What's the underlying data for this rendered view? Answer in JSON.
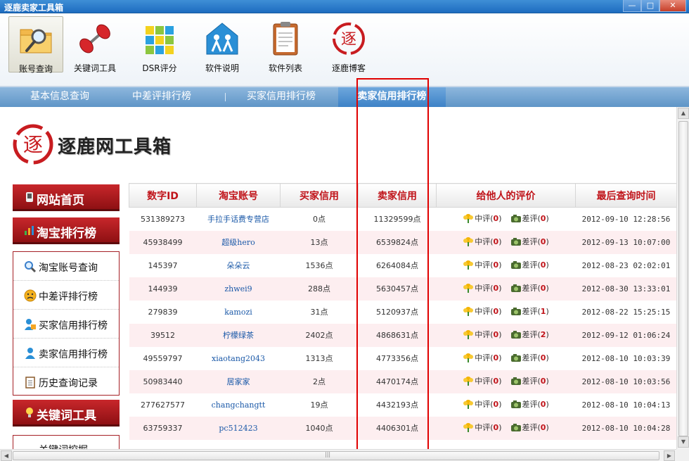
{
  "window": {
    "title": "逐鹿卖家工具箱",
    "min": "—",
    "max": "□",
    "close": "✕"
  },
  "toolbar": {
    "items": [
      {
        "label": "账号查询",
        "icon": "folder-search-icon"
      },
      {
        "label": "关键词工具",
        "icon": "dumbbell-icon"
      },
      {
        "label": "DSR评分",
        "icon": "cubes-icon"
      },
      {
        "label": "软件说明",
        "icon": "people-home-icon"
      },
      {
        "label": "软件列表",
        "icon": "clipboard-icon"
      },
      {
        "label": "逐鹿博客",
        "icon": "red-seal-icon"
      }
    ]
  },
  "tabs": [
    {
      "label": "基本信息查询"
    },
    {
      "label": "中差评排行榜"
    },
    {
      "label": "买家信用排行榜"
    },
    {
      "label": "卖家信用排行榜",
      "active": true
    }
  ],
  "logo": {
    "seal": "逐",
    "name": "逐鹿网工具箱"
  },
  "nav": {
    "home": "网站首页",
    "ranking": "淘宝排行榜",
    "items": [
      {
        "label": "淘宝账号查询",
        "icon": "magnifier-icon"
      },
      {
        "label": "中差评排行榜",
        "icon": "sad-face-icon"
      },
      {
        "label": "买家信用排行榜",
        "icon": "buyer-icon"
      },
      {
        "label": "卖家信用排行榜",
        "icon": "seller-icon"
      },
      {
        "label": "历史查询记录",
        "icon": "notepad-icon"
      }
    ],
    "keyword_tools": "关键词工具",
    "keyword_mining": "关键词挖掘"
  },
  "table": {
    "headers": [
      "数字ID",
      "淘宝账号",
      "买家信用",
      "卖家信用",
      "给他人的评价",
      "最后查询时间"
    ],
    "mid_label": "中评",
    "bad_label": "差评",
    "rows": [
      {
        "id": "531389273",
        "account": "手拉手话费专营店",
        "buyer": "0点",
        "seller": "11329599点",
        "mid": "0",
        "bad": "0",
        "time": "2012-09-10 12:28:56"
      },
      {
        "id": "45938499",
        "account": "超级hero",
        "buyer": "13点",
        "seller": "6539824点",
        "mid": "0",
        "bad": "0",
        "time": "2012-09-13 10:07:00"
      },
      {
        "id": "145397",
        "account": "朵朵云",
        "buyer": "1536点",
        "seller": "6264084点",
        "mid": "0",
        "bad": "0",
        "time": "2012-08-23 02:02:01"
      },
      {
        "id": "144939",
        "account": "zhwei9",
        "buyer": "288点",
        "seller": "5630457点",
        "mid": "0",
        "bad": "0",
        "time": "2012-08-30 13:33:01"
      },
      {
        "id": "279839",
        "account": "kamozi",
        "buyer": "31点",
        "seller": "5120937点",
        "mid": "0",
        "bad": "1",
        "time": "2012-08-22 15:25:15"
      },
      {
        "id": "39512",
        "account": "柠檬绿茶",
        "buyer": "2402点",
        "seller": "4868631点",
        "mid": "0",
        "bad": "2",
        "time": "2012-09-12 01:06:24"
      },
      {
        "id": "49559797",
        "account": "xiaotang2043",
        "buyer": "1313点",
        "seller": "4773356点",
        "mid": "0",
        "bad": "0",
        "time": "2012-08-10 10:03:39"
      },
      {
        "id": "50983440",
        "account": "居家家",
        "buyer": "2点",
        "seller": "4470174点",
        "mid": "0",
        "bad": "0",
        "time": "2012-08-10 10:03:56"
      },
      {
        "id": "277627577",
        "account": "changchangtt",
        "buyer": "19点",
        "seller": "4432193点",
        "mid": "0",
        "bad": "0",
        "time": "2012-08-10 10:04:13"
      },
      {
        "id": "63759337",
        "account": "pc512423",
        "buyer": "1040点",
        "seller": "4406301点",
        "mid": "0",
        "bad": "0",
        "time": "2012-08-10 10:04:28"
      }
    ]
  },
  "scroll": {
    "up": "▲",
    "down": "▼",
    "left": "◀",
    "right": "▶",
    "grip": "|||"
  },
  "colors": {
    "title_blue": "#1d6cc0",
    "tab_blue": "#5f95c7",
    "nav_red": "#b41e22",
    "header_red": "#c0141a",
    "highlight": "#e00000"
  }
}
